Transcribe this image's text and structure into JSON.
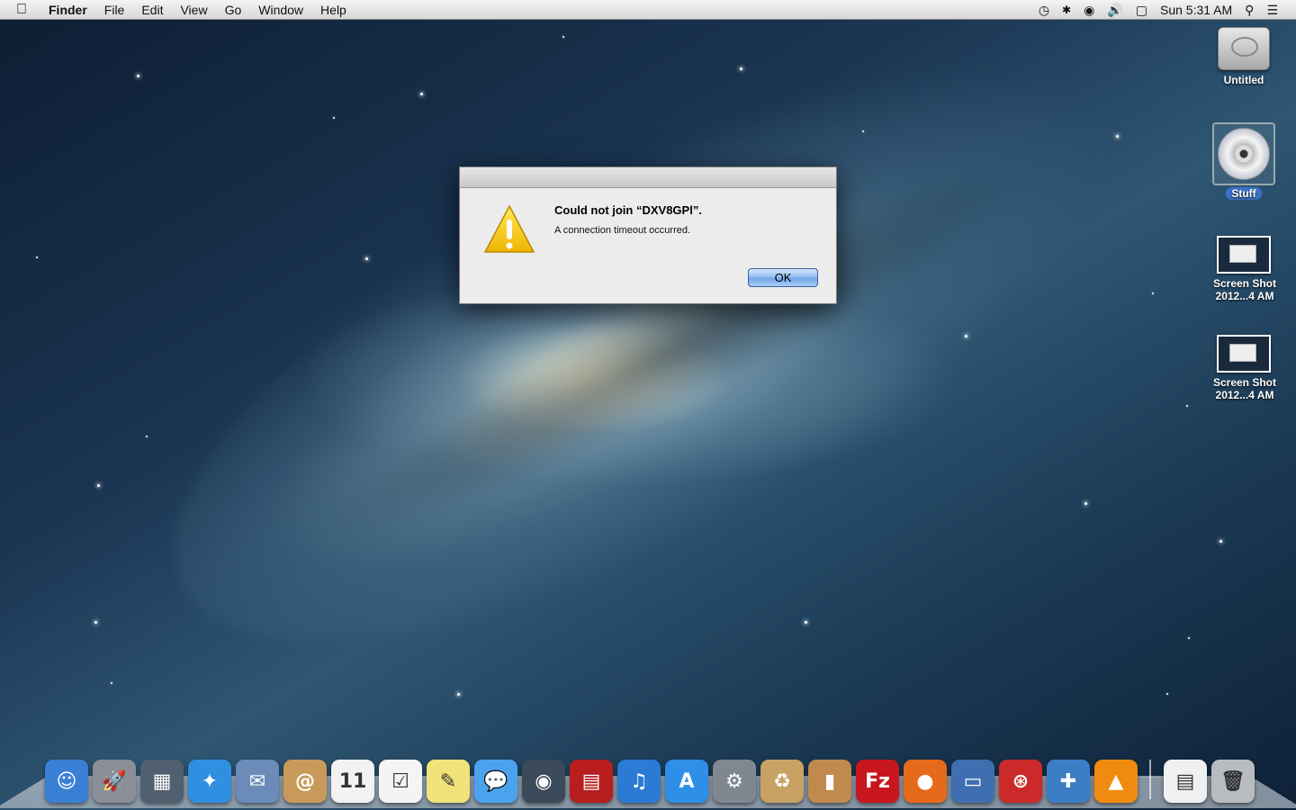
{
  "menubar": {
    "apple_icon": "apple-icon",
    "app_name": "Finder",
    "menus": [
      "File",
      "Edit",
      "View",
      "Go",
      "Window",
      "Help"
    ],
    "status_icons": [
      "time-machine-icon",
      "bluetooth-icon",
      "wifi-icon",
      "volume-icon",
      "battery-icon"
    ],
    "clock": "Sun 5:31 AM",
    "right_icons": [
      "spotlight-icon",
      "notification-center-icon"
    ]
  },
  "desktop": {
    "icons": [
      {
        "label": "Untitled",
        "kind": "hard-drive-icon",
        "selected": false
      },
      {
        "label": "Stuff",
        "kind": "cd-disc-icon",
        "selected": true
      },
      {
        "label": "Screen Shot 2012...4 AM",
        "kind": "screenshot-file-icon",
        "selected": false
      },
      {
        "label": "Screen Shot 2012...4 AM",
        "kind": "screenshot-file-icon",
        "selected": false
      }
    ]
  },
  "dialog": {
    "title": "Could not join “DXV8GPl”.",
    "message": "A connection timeout occurred.",
    "ok_label": "OK",
    "icon": "warning-icon"
  },
  "dock": {
    "apps": [
      {
        "name": "finder-icon",
        "glyph": "☺",
        "color": "#3a7fd6"
      },
      {
        "name": "launchpad-icon",
        "glyph": "🚀",
        "color": "#8a8f97"
      },
      {
        "name": "mission-control-icon",
        "glyph": "▦",
        "color": "#506070"
      },
      {
        "name": "safari-icon",
        "glyph": "✦",
        "color": "#2f8fe0"
      },
      {
        "name": "mail-icon",
        "glyph": "✉",
        "color": "#6b8bb8"
      },
      {
        "name": "contacts-icon",
        "glyph": "@",
        "color": "#c89a5a"
      },
      {
        "name": "calendar-icon",
        "glyph": "11",
        "color": "#f2f2f2"
      },
      {
        "name": "reminders-icon",
        "glyph": "☑",
        "color": "#f4f4f4"
      },
      {
        "name": "notes-icon",
        "glyph": "✎",
        "color": "#f1e27a"
      },
      {
        "name": "messages-icon",
        "glyph": "💬",
        "color": "#4ba3f0"
      },
      {
        "name": "facetime-icon",
        "glyph": "◉",
        "color": "#3a4a5a"
      },
      {
        "name": "photo-booth-icon",
        "glyph": "▤",
        "color": "#b81e1e"
      },
      {
        "name": "itunes-icon",
        "glyph": "♫",
        "color": "#2a7ad6"
      },
      {
        "name": "app-store-icon",
        "glyph": "A",
        "color": "#2e8fe8"
      },
      {
        "name": "system-preferences-icon",
        "glyph": "⚙",
        "color": "#7f8790"
      },
      {
        "name": "archive-utility-icon",
        "glyph": "♻",
        "color": "#c8a165"
      },
      {
        "name": "compress-icon",
        "glyph": "▮",
        "color": "#c08a4e"
      },
      {
        "name": "filezilla-icon",
        "glyph": "Fz",
        "color": "#c8161e"
      },
      {
        "name": "firefox-icon",
        "glyph": "●",
        "color": "#e56a1a"
      },
      {
        "name": "remote-desktop-icon",
        "glyph": "▭",
        "color": "#3f6fb0"
      },
      {
        "name": "disk-utility-icon",
        "glyph": "⊛",
        "color": "#cc2a2a"
      },
      {
        "name": "automator-icon",
        "glyph": "✚",
        "color": "#3c7ec6"
      },
      {
        "name": "vlc-icon",
        "glyph": "▲",
        "color": "#f08a10"
      }
    ],
    "right_items": [
      {
        "name": "document-stack-icon",
        "glyph": "▤",
        "color": "#eef0f2"
      },
      {
        "name": "trash-icon",
        "glyph": "🗑",
        "color": "#b8bcc0"
      }
    ]
  }
}
